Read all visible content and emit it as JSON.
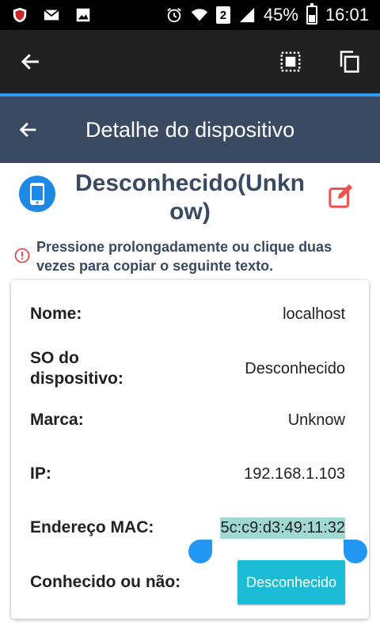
{
  "status_bar": {
    "battery_percent": "45%",
    "time": "16:01",
    "sim_slot": "2",
    "icons": [
      "shield-icon",
      "mail-icon",
      "image-icon",
      "alarm-icon",
      "wifi-icon",
      "signal-icon",
      "battery-icon"
    ]
  },
  "action_bar": {
    "icons": [
      "back-arrow-icon",
      "select-all-icon",
      "copy-icon"
    ]
  },
  "header": {
    "title": "Detalhe do dispositivo"
  },
  "device": {
    "name": "Desconhecido(Unknow)",
    "icon": "smartphone-icon"
  },
  "hint": {
    "text": "Pressione prolongadamente ou clique duas vezes para copiar o seguinte texto."
  },
  "details": {
    "name_label": "Nome:",
    "name_value": "localhost",
    "os_label": "SO do dispositivo:",
    "os_value": "Desconhecido",
    "brand_label": "Marca:",
    "brand_value": "Unknow",
    "ip_label": "IP:",
    "ip_value": "192.168.1.103",
    "mac_label": "Endereço MAC:",
    "mac_value": "5c:c9:d3:49:11:32",
    "known_label": "Conhecido ou não:",
    "known_value": "Desconhecido"
  },
  "colors": {
    "header_bg": "#3b4a63",
    "accent": "#2f9bf2",
    "status_button": "#1cbcd6",
    "selection_highlight": "#9fd9d2",
    "edit_icon": "#ef5350"
  }
}
